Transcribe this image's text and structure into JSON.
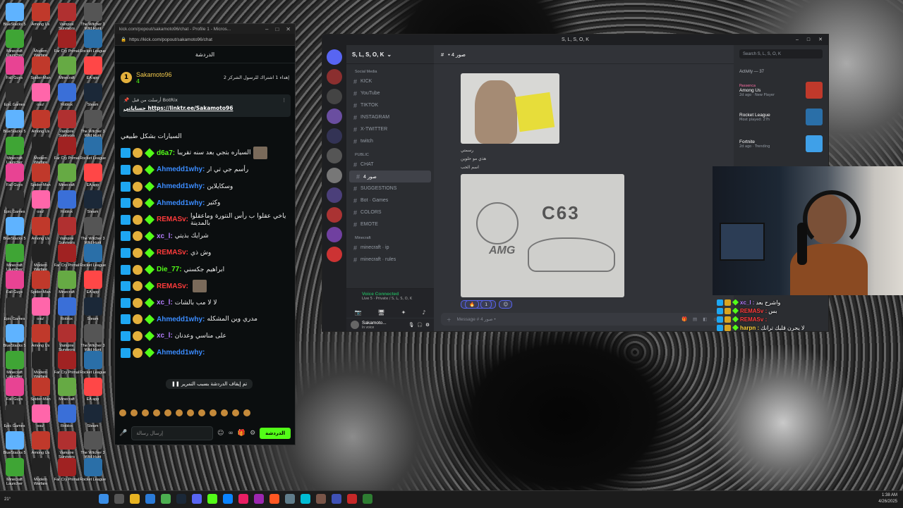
{
  "desktop": {
    "icons": [
      {
        "label": "BlueStacks 5",
        "color": "#5fb3ff"
      },
      {
        "label": "Among Us",
        "color": "#c0392b"
      },
      {
        "label": "Vampire Survivors",
        "color": "#b03030"
      },
      {
        "label": "The Witcher 3 Wild Hunt",
        "color": "#555555"
      },
      {
        "label": "Minecraft Launcher",
        "color": "#3fa535"
      },
      {
        "label": "Modern Warfare",
        "color": "#222222"
      },
      {
        "label": "Far Cry Primal",
        "color": "#a02222"
      },
      {
        "label": "Rocket League",
        "color": "#2a6fa8"
      },
      {
        "label": "Fall Guys",
        "color": "#e84393"
      },
      {
        "label": "Spider-Man",
        "color": "#c0392b"
      },
      {
        "label": "Minecraft",
        "color": "#6a4"
      },
      {
        "label": "EA app",
        "color": "#ff4747"
      },
      {
        "label": "Epic Games",
        "color": "#2c2c2c"
      },
      {
        "label": "osu!",
        "color": "#ff66aa"
      },
      {
        "label": "Roblox",
        "color": "#3a6fd8"
      },
      {
        "label": "Steam",
        "color": "#1b2838"
      }
    ]
  },
  "kick": {
    "window_title": "kick.com/popout/sakamoto96/chat - Profile 1 - Micros...",
    "url": "https://kick.com/popout/sakamoto96/chat",
    "header": "الدردشة",
    "pinned": {
      "name": "Sakamoto96",
      "sub": "4",
      "badge": "1",
      "text": "إهداء 1 اشتراك للرسول الشركز 2"
    },
    "bot": {
      "line1": "أرسلت من قبل BotRix",
      "line2": "حساباتي https://linktr.ee/Sakamoto96"
    },
    "messages": [
      {
        "user": "",
        "color": "#ffffff",
        "text": "السيارات بشكل طبيعي",
        "thumb": false
      },
      {
        "user": "d6a7:",
        "color": "#53fc18",
        "text": "السياره بتجي بعد سنه تقريبا",
        "thumb": true
      },
      {
        "user": "Ahmedd1why:",
        "color": "#3b8cff",
        "text": "رأسم جي تي ار",
        "thumb": false
      },
      {
        "user": "Ahmedd1why:",
        "color": "#3b8cff",
        "text": "وسكايلاين",
        "thumb": false
      },
      {
        "user": "Ahmedd1why:",
        "color": "#3b8cff",
        "text": "وكثير",
        "thumb": false
      },
      {
        "user": "REMASv:",
        "color": "#ff3b3b",
        "text": "ياخي عقلوا ب رأس النتورة وماعقلوا بالمدينة",
        "thumb": false
      },
      {
        "user": "xc_l:",
        "color": "#b57cff",
        "text": "شرايك بذيتي",
        "thumb": false
      },
      {
        "user": "REMASv:",
        "color": "#ff3b3b",
        "text": "وش ذي",
        "thumb": false
      },
      {
        "user": "Die_77:",
        "color": "#53fc18",
        "text": "ابراهيم جكسني",
        "thumb": false
      },
      {
        "user": "REMASv:",
        "color": "#ff3b3b",
        "text": "",
        "thumb": true
      },
      {
        "user": "xc_l:",
        "color": "#b57cff",
        "text": "لا لا مب بالشات",
        "thumb": false
      },
      {
        "user": "Ahmedd1why:",
        "color": "#3b8cff",
        "text": "مدري وين المشكله",
        "thumb": false
      },
      {
        "user": "xc_l:",
        "color": "#b57cff",
        "text": "على مناسي وعدنان",
        "thumb": false
      },
      {
        "user": "Ahmedd1why:",
        "color": "#3b8cff",
        "text": "",
        "thumb": false
      }
    ],
    "paused": "تم إيقاف الدردشة بسبب التمرير",
    "input_placeholder": "إرسال رسالة",
    "send_label": "الدردشة"
  },
  "discord": {
    "window_title": "S, L, S, O, K",
    "server_name": "S, L, S, O, K",
    "current_channel": "• صور 4",
    "search_placeholder": "Search S, L, S, O, K",
    "categories": [
      {
        "name": "Social Media",
        "channels": [
          "KICK",
          "YouTube",
          "TIKTOK",
          "INSTAGRAM",
          "X-TWITTER",
          "twitch"
        ]
      },
      {
        "name": "PUBLIC",
        "channels": [
          "CHAT",
          "صور 4",
          "SUGGESTIONS",
          "Bot · Games",
          "COLORS",
          "EMOTE"
        ]
      },
      {
        "name": "Minecraft",
        "channels": [
          "minecraft · ip",
          "minecraft · rules"
        ]
      }
    ],
    "voice": {
      "status": "Voice Connected",
      "sub": "Live 5 · Private / S, L, S, O, K"
    },
    "user": {
      "name": "Sakamoto...",
      "status": "In voice"
    },
    "captions": [
      "رسمتي",
      "هذي مو حلوين",
      "اسم الحب"
    ],
    "image2": {
      "plate": "C63",
      "brand": "AMG"
    },
    "reaction": {
      "emoji": "🔥",
      "count": "1"
    },
    "message_placeholder": "Message # صور 4 •",
    "activity": {
      "title": "Activity — 37",
      "games": [
        {
          "name": "Among Us",
          "sub": "2d ago · New Player",
          "user": "Passenca",
          "color": "#c0392b"
        },
        {
          "name": "Rocket League",
          "sub": "Most played: 27h",
          "user": "",
          "color": "#2a6fa8"
        },
        {
          "name": "Fortnite",
          "sub": "2d ago · Trending",
          "user": "",
          "color": "#3fa0e8"
        }
      ]
    }
  },
  "overlay": [
    {
      "user": "xc_l :",
      "color": "#b57cff",
      "text": "واشرح بعد"
    },
    {
      "user": "REMASv :",
      "color": "#ff3b3b",
      "text": "بس"
    },
    {
      "user": "REMASv :",
      "color": "#ff3b3b",
      "text": ""
    },
    {
      "user": "harpn :",
      "color": "#ffd43b",
      "text": "لا يحرن قلبك ترانك"
    }
  ],
  "taskbar": {
    "weather": "21°",
    "time": "1:38 AM",
    "date": "4/26/2025"
  }
}
